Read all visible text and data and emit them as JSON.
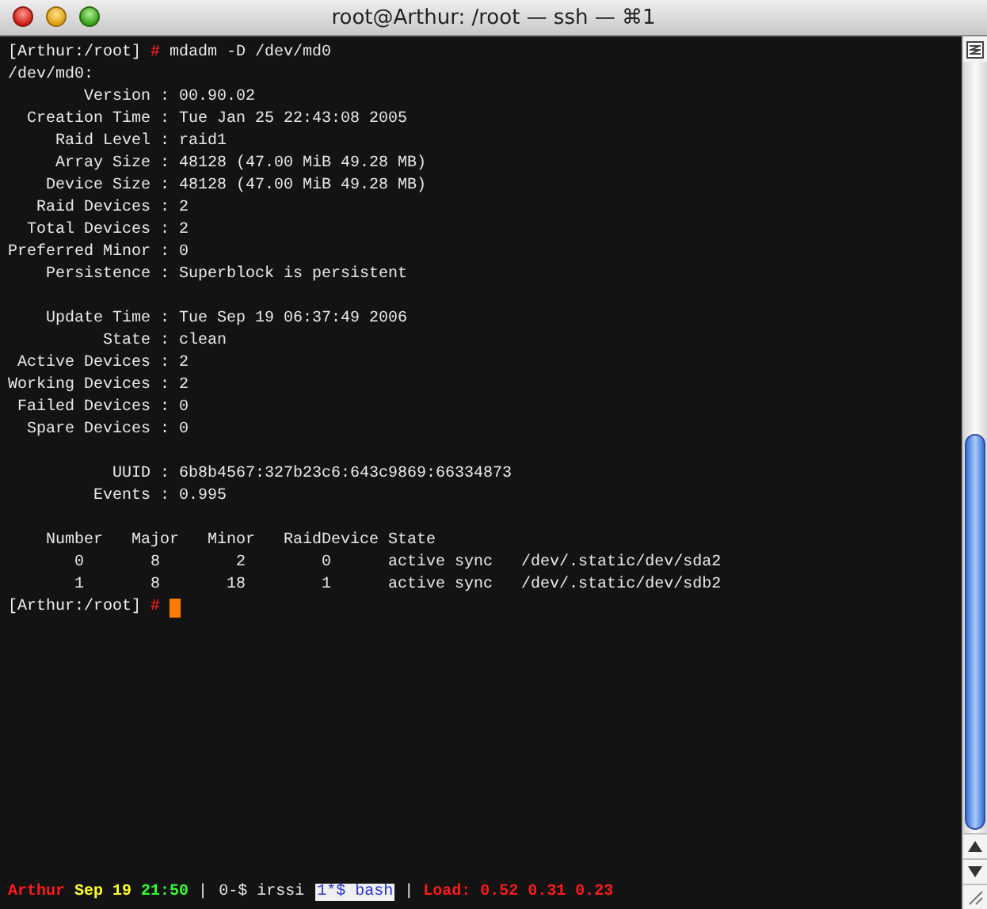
{
  "window": {
    "title": "root@Arthur: /root — ssh — ⌘1"
  },
  "terminal": {
    "lines": [
      {
        "kind": "prompt",
        "host_path": "[Arthur:/root]",
        "symbol": "#",
        "command": "mdadm -D /dev/md0",
        "cursor": false
      },
      {
        "kind": "text",
        "text": "/dev/md0:"
      },
      {
        "kind": "text",
        "text": "        Version : 00.90.02"
      },
      {
        "kind": "text",
        "text": "  Creation Time : Tue Jan 25 22:43:08 2005"
      },
      {
        "kind": "text",
        "text": "     Raid Level : raid1"
      },
      {
        "kind": "text",
        "text": "     Array Size : 48128 (47.00 MiB 49.28 MB)"
      },
      {
        "kind": "text",
        "text": "    Device Size : 48128 (47.00 MiB 49.28 MB)"
      },
      {
        "kind": "text",
        "text": "   Raid Devices : 2"
      },
      {
        "kind": "text",
        "text": "  Total Devices : 2"
      },
      {
        "kind": "text",
        "text": "Preferred Minor : 0"
      },
      {
        "kind": "text",
        "text": "    Persistence : Superblock is persistent"
      },
      {
        "kind": "blank"
      },
      {
        "kind": "text",
        "text": "    Update Time : Tue Sep 19 06:37:49 2006"
      },
      {
        "kind": "text",
        "text": "          State : clean"
      },
      {
        "kind": "text",
        "text": " Active Devices : 2"
      },
      {
        "kind": "text",
        "text": "Working Devices : 2"
      },
      {
        "kind": "text",
        "text": " Failed Devices : 0"
      },
      {
        "kind": "text",
        "text": "  Spare Devices : 0"
      },
      {
        "kind": "blank"
      },
      {
        "kind": "text",
        "text": "           UUID : 6b8b4567:327b23c6:643c9869:66334873"
      },
      {
        "kind": "text",
        "text": "         Events : 0.995"
      },
      {
        "kind": "blank"
      },
      {
        "kind": "text",
        "text": "    Number   Major   Minor   RaidDevice State"
      },
      {
        "kind": "text",
        "text": "       0       8        2        0      active sync   /dev/.static/dev/sda2"
      },
      {
        "kind": "text",
        "text": "       1       8       18        1      active sync   /dev/.static/dev/sdb2"
      },
      {
        "kind": "prompt",
        "host_path": "[Arthur:/root]",
        "symbol": "#",
        "cursor": true
      }
    ]
  },
  "status_bar": {
    "items": [
      {
        "kind": "text",
        "text": "Arthur",
        "color": "#ff1a1a"
      },
      {
        "kind": "text",
        "text": "Sep 19",
        "color": "#ffff33"
      },
      {
        "kind": "text",
        "text": "21:50",
        "color": "#33ff33"
      },
      {
        "kind": "separator",
        "text": "|"
      },
      {
        "kind": "window",
        "text": "0-$ irssi",
        "selected": false
      },
      {
        "kind": "window",
        "text": "1*$ bash",
        "selected": true
      },
      {
        "kind": "separator",
        "text": "|"
      },
      {
        "kind": "text",
        "text": "Load: 0.52 0.31 0.23",
        "color": "#ff1a1a"
      }
    ]
  }
}
